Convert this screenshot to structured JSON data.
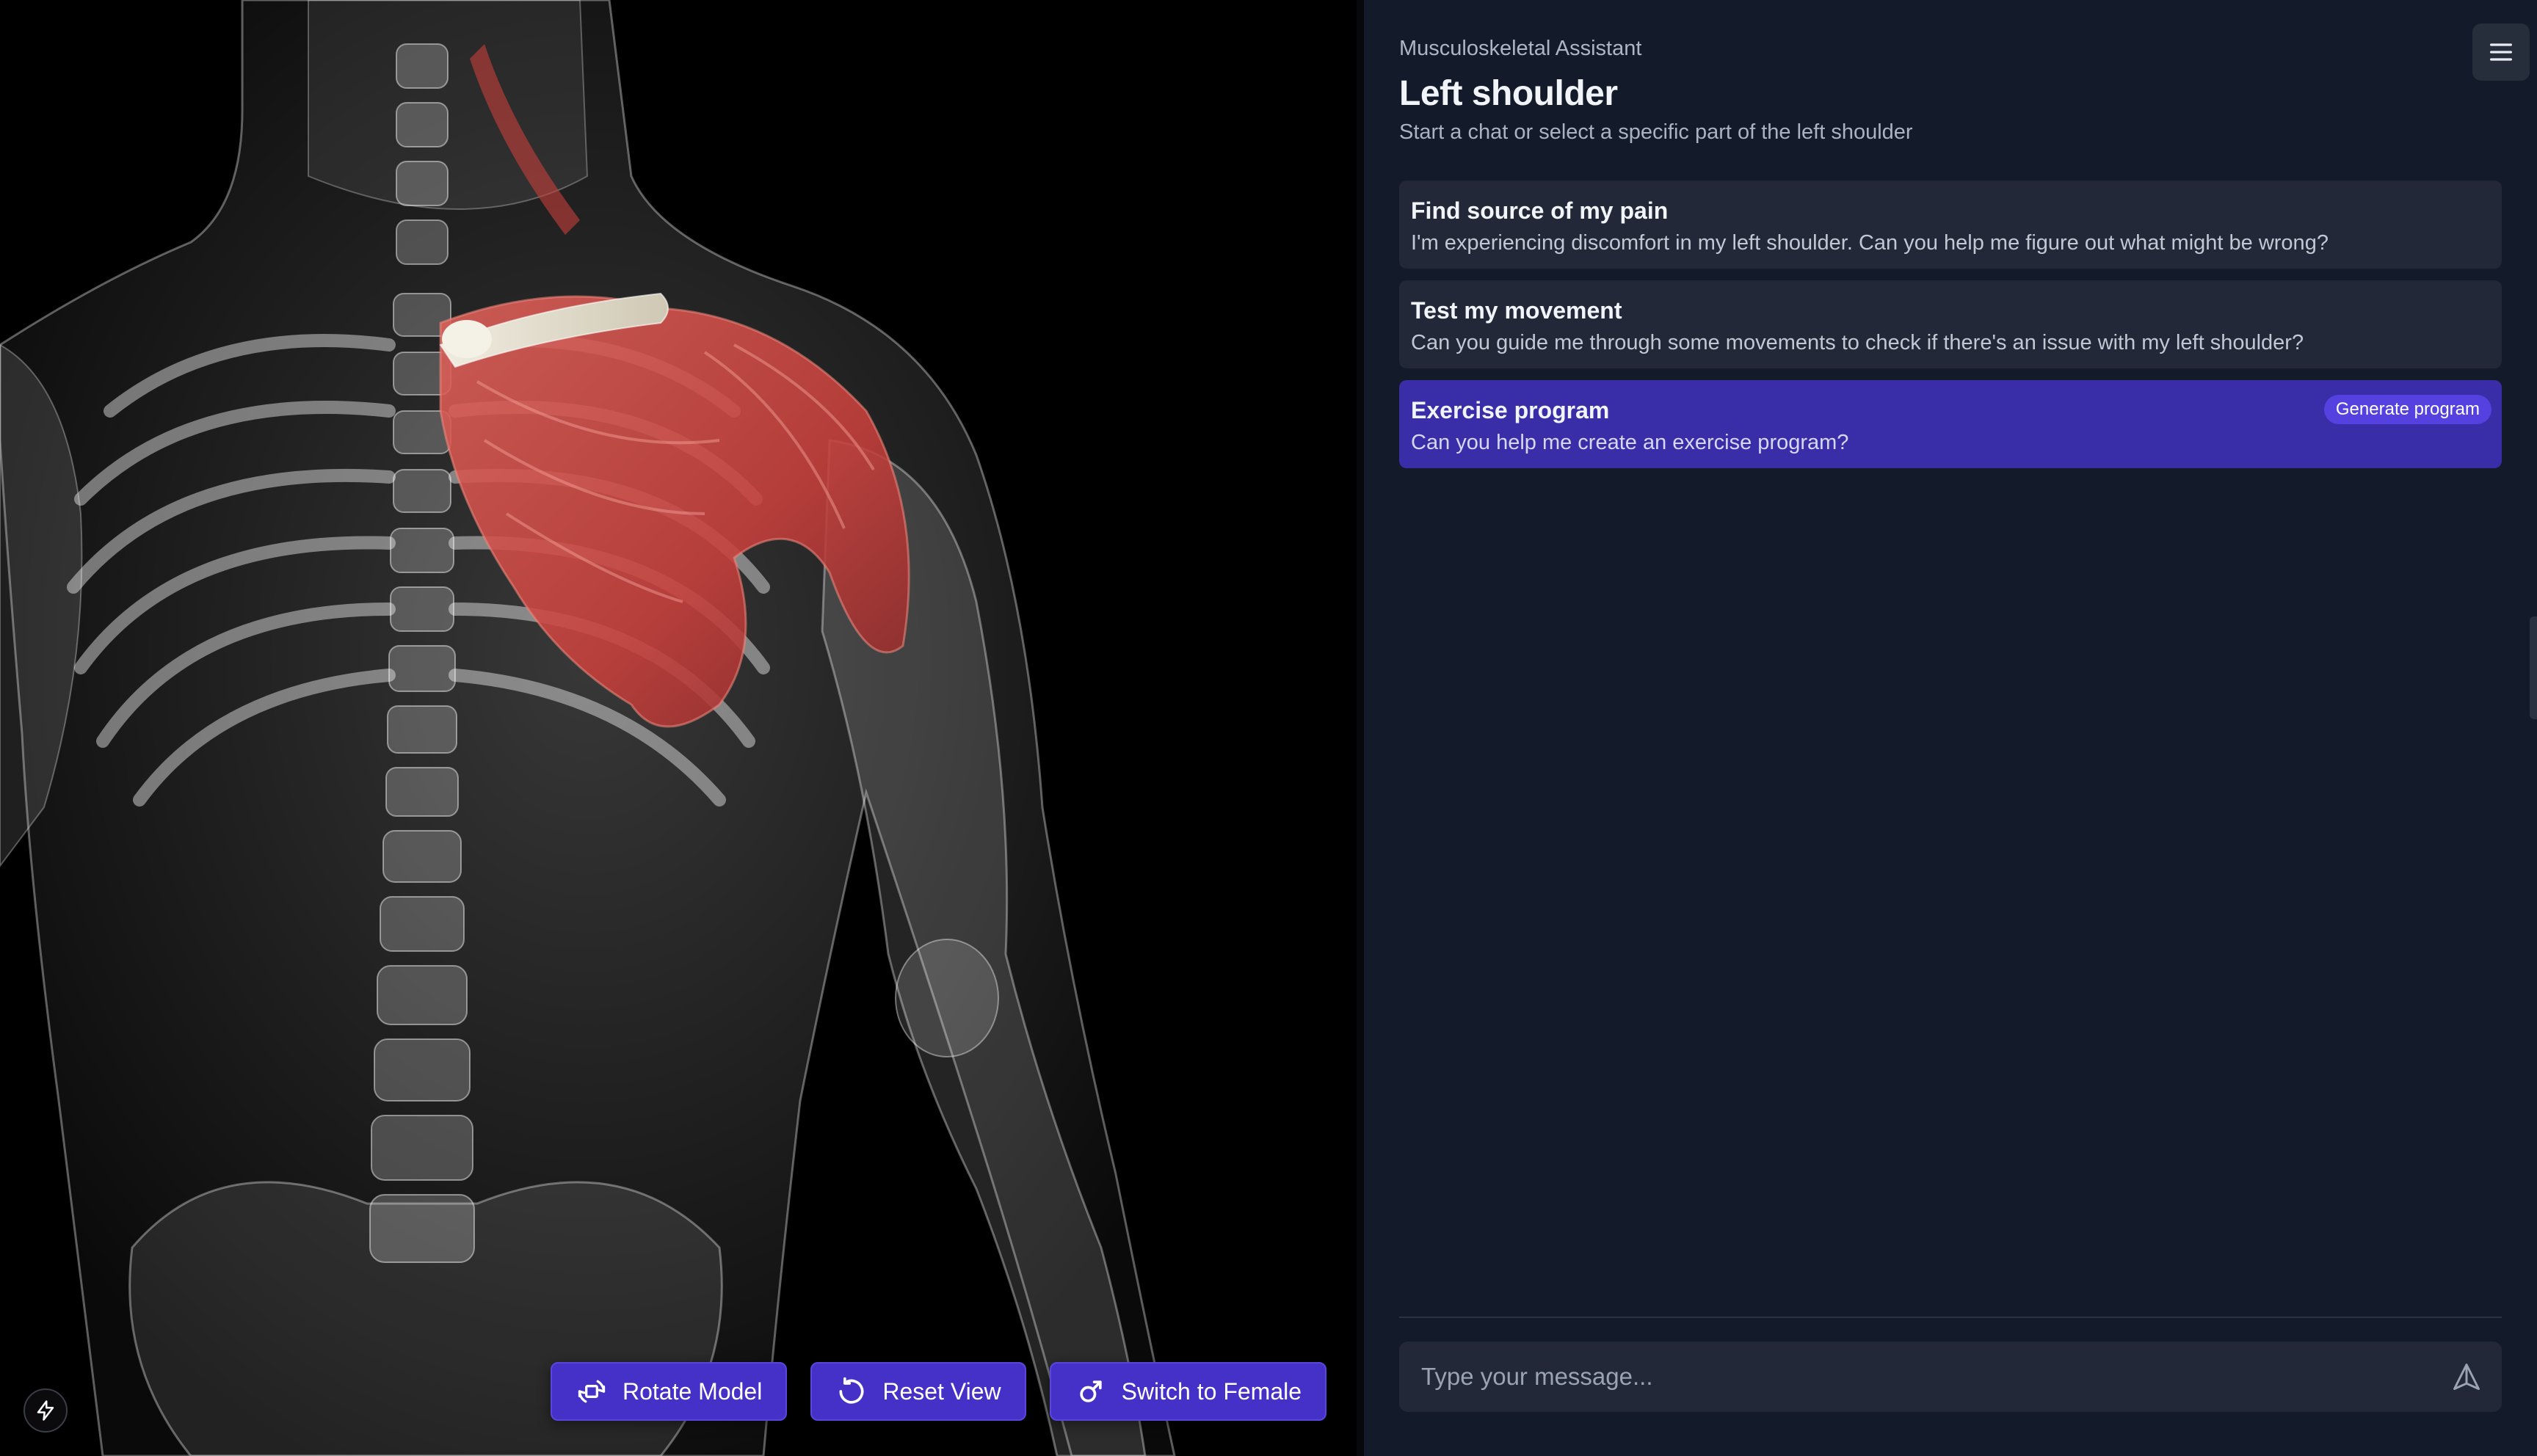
{
  "viewer": {
    "toolbar": {
      "rotate_label": "Rotate Model",
      "reset_label": "Reset View",
      "switch_label": "Switch to Female"
    },
    "icons": {
      "rotate": "rotate-3d-icon",
      "reset": "rotate-ccw-icon",
      "switch": "mars-icon",
      "badge": "bolt-icon"
    },
    "highlight_color": "#c8403c"
  },
  "assistant": {
    "app_name": "Musculoskeletal Assistant",
    "title": "Left shoulder",
    "subtitle": "Start a chat or select a specific part of the left shoulder",
    "cards": [
      {
        "title": "Find source of my pain",
        "description": "I'm experiencing discomfort in my left shoulder. Can you help me figure out what might be wrong?",
        "active": false,
        "action": ""
      },
      {
        "title": "Test my movement",
        "description": "Can you guide me through some movements to check if there's an issue with my left shoulder?",
        "active": false,
        "action": ""
      },
      {
        "title": "Exercise program",
        "description": "Can you help me create an exercise program?",
        "active": true,
        "action": "Generate program"
      }
    ],
    "input": {
      "placeholder": "Type your message...",
      "value": ""
    }
  },
  "colors": {
    "panel_bg": "#131a29",
    "card_bg": "#222837",
    "accent": "#3a2ea8",
    "button": "#4530c8"
  }
}
